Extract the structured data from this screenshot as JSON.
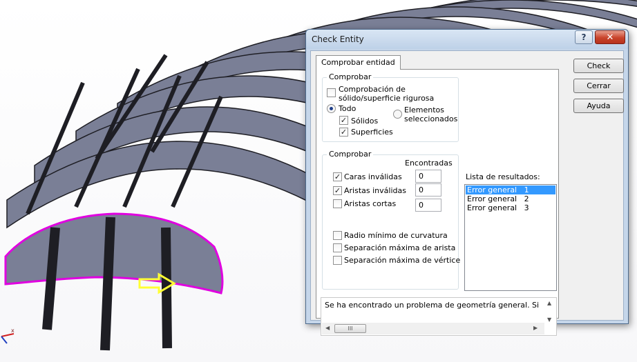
{
  "dialog": {
    "title": "Check Entity",
    "help_glyph": "?",
    "close_glyph": "✕"
  },
  "tab": {
    "label": "Comprobar entidad"
  },
  "check_group": {
    "legend": "Comprobar",
    "strict_line1": "Comprobación de",
    "strict_line2": "sólido/superficie rigurosa",
    "all_label": "Todo",
    "selected_line1": "Elementos",
    "selected_line2": "seleccionados",
    "solids_label": "Sólidos",
    "surfaces_label": "Superficies"
  },
  "check_group2": {
    "legend": "Comprobar",
    "found_header": "Encontradas",
    "rows": [
      {
        "label": "Caras inválidas",
        "checked": true,
        "value": "0"
      },
      {
        "label": "Aristas inválidas",
        "checked": true,
        "value": "0"
      },
      {
        "label": "Aristas cortas",
        "checked": false,
        "value": "0"
      }
    ],
    "extra": [
      "Radio mínimo de curvatura",
      "Separación máxima de arista",
      "Separación máxima de vértice"
    ]
  },
  "results": {
    "label": "Lista de resultados:",
    "items": [
      "Error general   1",
      "Error general   2",
      "Error general   3"
    ]
  },
  "message": "Se ha encontrado un problema de geometría general. Si los",
  "scroll": {
    "grip": "III"
  },
  "buttons": {
    "check": "Check",
    "close": "Cerrar",
    "help": "Ayuda"
  },
  "colors": {
    "model_fill": "#7a7f96",
    "model_edge": "#1e1e24",
    "highlight": "#e000e0",
    "arrow": "#ffff33"
  }
}
